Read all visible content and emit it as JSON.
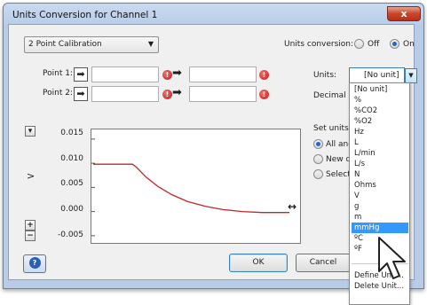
{
  "window": {
    "title": "Units Conversion for Channel 1",
    "close_label": "x"
  },
  "calibration": {
    "mode": "2 Point Calibration"
  },
  "units_conversion": {
    "label": "Units conversion:",
    "off": "Off",
    "on": "On",
    "selected": "On"
  },
  "points": [
    {
      "label": "Point 1:",
      "value_a": "",
      "value_b": ""
    },
    {
      "label": "Point 2:",
      "value_a": "",
      "value_b": ""
    }
  ],
  "units": {
    "label": "Units:",
    "value": "[No unit]"
  },
  "decimal": {
    "label": "Decimal p"
  },
  "set_units": {
    "label": "Set units",
    "options": [
      "All anc",
      "New d",
      "Select"
    ],
    "selected": "All anc"
  },
  "graph": {
    "y_up": "▾",
    "y_axis_arrow": ">",
    "zoom_in": "+",
    "zoom_out": "−"
  },
  "chart_data": {
    "type": "line",
    "yticks": [
      "0.015",
      "0.010",
      "0.005",
      "0.000",
      "-0.005"
    ],
    "ylim": [
      -0.0065,
      0.017
    ],
    "x": [
      0,
      0.2,
      0.22,
      0.27,
      0.33,
      0.4,
      0.48,
      0.57,
      0.66,
      0.76,
      0.86,
      0.96,
      1.0
    ],
    "values": [
      0.0098,
      0.0098,
      0.0092,
      0.0071,
      0.0052,
      0.0035,
      0.0021,
      0.0011,
      0.0004,
      0.0,
      -0.0002,
      -0.0002,
      -0.0002
    ],
    "color": "#c0282a"
  },
  "buttons": {
    "help": "?",
    "ok": "OK",
    "cancel": "Cancel"
  },
  "dropdown": {
    "items": [
      "[No unit]",
      "%",
      "%CO2",
      "%O2",
      "Hz",
      "L",
      "L/min",
      "L/s",
      "N",
      "Ohms",
      "V",
      "g",
      "m",
      "mmHg",
      "ºC",
      "ºF"
    ],
    "selected": "mmHg",
    "actions": [
      "Define Unit...",
      "Delete Unit..."
    ]
  },
  "colors": {
    "accent": "#3399ff",
    "trace": "#c0282a",
    "error": "#c81818"
  }
}
